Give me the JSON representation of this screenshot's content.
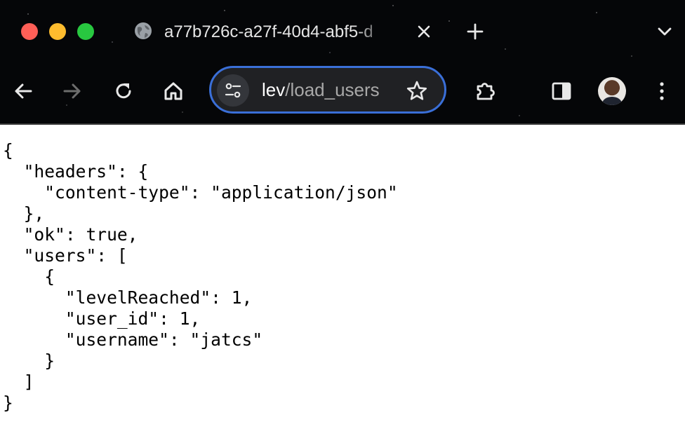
{
  "tab": {
    "title": "a77b726c-a27f-40d4-abf5-d"
  },
  "address_bar": {
    "url_visible": "lev/load_users",
    "url_visible_prefix": "lev",
    "url_visible_path": "/load_users"
  },
  "icons": {
    "traffic_lights": [
      "close-red",
      "minimize-yellow",
      "zoom-green"
    ],
    "tab_favicon": "globe-icon",
    "toolbar": [
      "back-arrow-icon",
      "forward-arrow-icon",
      "reload-icon",
      "home-icon",
      "site-info-icon",
      "bookmark-star-icon",
      "extensions-puzzle-icon",
      "side-panel-icon",
      "profile-avatar",
      "more-menu-icon"
    ]
  },
  "colors": {
    "omnibox_border": "#3a6fd8",
    "chrome_bg": "#050608",
    "page_bg": "#ffffff"
  },
  "json_lines": [
    "{",
    "  \"headers\": {",
    "    \"content-type\": \"application/json\"",
    "  },",
    "  \"ok\": true,",
    "  \"users\": [",
    "    {",
    "      \"levelReached\": 1,",
    "      \"user_id\": 1,",
    "      \"username\": \"jatcs\"",
    "    }",
    "  ]",
    "}"
  ]
}
